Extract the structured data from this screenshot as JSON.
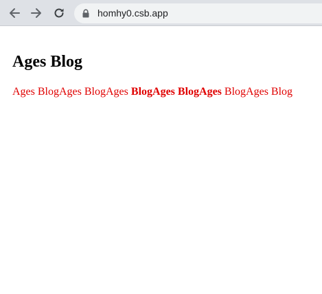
{
  "browser": {
    "url": "homhy0.csb.app",
    "icons": {
      "back": "arrow-left-icon",
      "forward": "arrow-right-icon",
      "reload": "reload-icon",
      "lock": "lock-icon"
    }
  },
  "page": {
    "title": "Ages Blog",
    "text_color": "#e00000",
    "segments": [
      {
        "text": "Ages Blog",
        "bold": false
      },
      {
        "text": "Ages Blog",
        "bold": false
      },
      {
        "text": "Ages ",
        "bold": false
      },
      {
        "text": "Blog",
        "bold": true
      },
      {
        "text": "Ages Blog",
        "bold": true
      },
      {
        "text": "Ages ",
        "bold": true
      },
      {
        "text": "Blog",
        "bold": false
      },
      {
        "text": "Ages Blog",
        "bold": false
      }
    ]
  }
}
